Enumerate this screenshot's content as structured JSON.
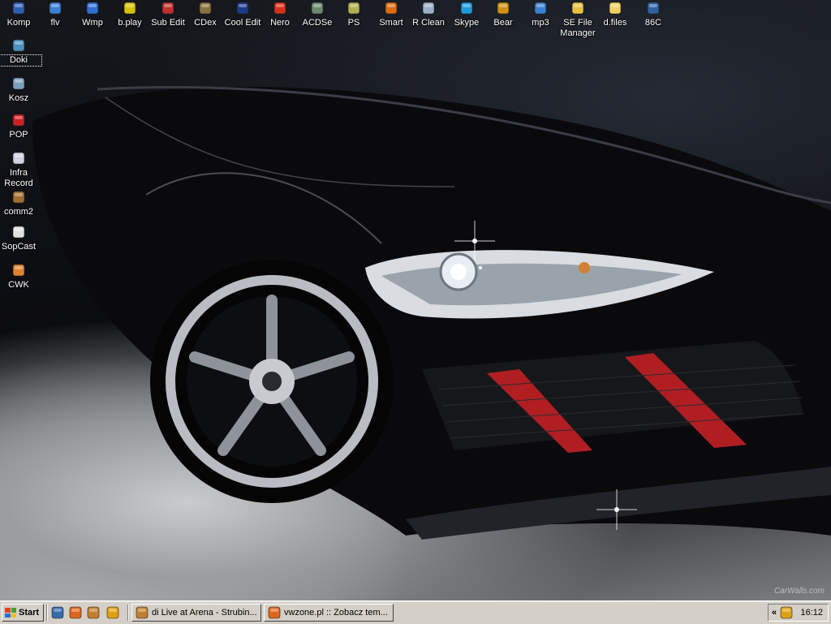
{
  "desktop": {
    "top_icons": [
      {
        "label": "Komp",
        "icon": "my-computer-icon",
        "color": "#2b5fb4"
      },
      {
        "label": "flv",
        "icon": "flv-player-icon",
        "color": "#3a7fd6"
      },
      {
        "label": "Wmp",
        "icon": "media-player-icon",
        "color": "#2f6fd0"
      },
      {
        "label": "b.play",
        "icon": "bsplayer-icon",
        "color": "#d8c000"
      },
      {
        "label": "Sub Edit",
        "icon": "subtitle-edit-icon",
        "color": "#c03030"
      },
      {
        "label": "CDex",
        "icon": "cdex-icon",
        "color": "#8a7040"
      },
      {
        "label": "Cool Edit",
        "icon": "cool-edit-icon",
        "color": "#1a3a8a"
      },
      {
        "label": "Nero",
        "icon": "nero-icon",
        "color": "#d83018"
      },
      {
        "label": "ACDSe",
        "icon": "acdsee-icon",
        "color": "#6a8a6a"
      },
      {
        "label": "PS",
        "icon": "photoshop-icon",
        "color": "#b0b050"
      },
      {
        "label": "Smart",
        "icon": "smart-flame-icon",
        "color": "#e06a10"
      },
      {
        "label": "R Clean",
        "icon": "registry-clean-icon",
        "color": "#9ab0c8"
      },
      {
        "label": "Skype",
        "icon": "skype-icon",
        "color": "#1a9ae0"
      },
      {
        "label": "Bear",
        "icon": "bearshare-icon",
        "color": "#d09010"
      },
      {
        "label": "mp3",
        "icon": "mp3-disc-icon",
        "color": "#3a80d0"
      },
      {
        "label": "SE File\nManager",
        "icon": "folder-tools-icon",
        "color": "#e8c040"
      },
      {
        "label": "d.files",
        "icon": "folder-icon",
        "color": "#f0d060"
      },
      {
        "label": "86C",
        "icon": "lock-app-icon",
        "color": "#3060a0"
      }
    ],
    "left_icons": [
      {
        "label": "Doki",
        "icon": "documents-icon",
        "color": "#4a90c0",
        "selected": true
      },
      {
        "label": "Kosz",
        "icon": "recycle-bin-icon",
        "color": "#7aa0c0"
      },
      {
        "label": "POP",
        "icon": "pop-target-icon",
        "color": "#d02020"
      },
      {
        "label": "Infra\nRecord",
        "icon": "infra-record-icon",
        "color": "#d0d0e0"
      },
      {
        "label": "comm2",
        "icon": "comm-figure-icon",
        "color": "#a07030"
      },
      {
        "label": "SopCast",
        "icon": "sopcast-icon",
        "color": "#e0e0e0"
      },
      {
        "label": "CWK",
        "icon": "cwk-app-icon",
        "color": "#e08030"
      }
    ],
    "watermark": "CarWalls.com"
  },
  "taskbar": {
    "start_label": "Start",
    "quick_launch": [
      {
        "icon": "show-desktop-icon",
        "color": "#3a6ab0"
      },
      {
        "icon": "firefox-icon",
        "color": "#e0661a"
      },
      {
        "icon": "winamp-icon",
        "color": "#c08030"
      },
      {
        "icon": "sun-app-icon",
        "color": "#e0a010"
      }
    ],
    "tasks": [
      {
        "label": "di Live at Arena - Strubin...",
        "icon": "winamp-task-icon",
        "color": "#c08030"
      },
      {
        "label": "vwzone.pl :: Zobacz tem...",
        "icon": "firefox-task-icon",
        "color": "#e0661a"
      }
    ],
    "tray": {
      "chevron": "«",
      "tray_icon": "tray-sun-icon",
      "time": "16:12"
    }
  }
}
